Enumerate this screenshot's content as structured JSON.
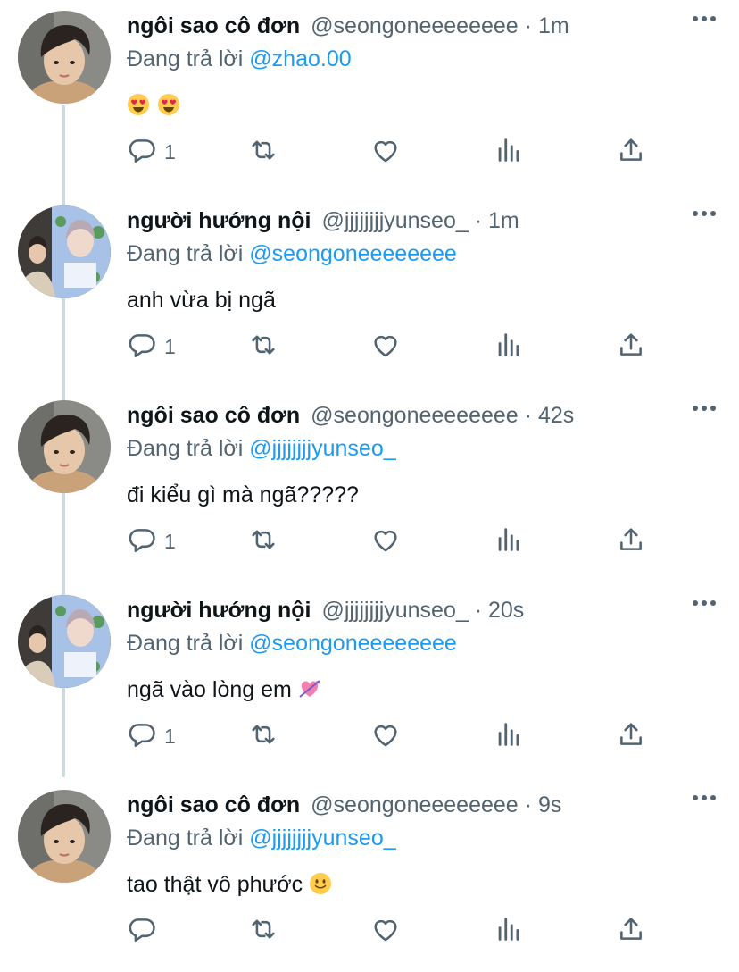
{
  "colors": {
    "link": "#1d9bf0",
    "secondary": "#536471",
    "text": "#0f1419",
    "thread_line": "#cfd9de"
  },
  "tweets": [
    {
      "name": "ngôi sao cô đơn",
      "handle": "@seongoneeeeeeee",
      "time": "1m",
      "replying_label": "Đang trả lời",
      "replying_to": "@zhao.00",
      "text": "",
      "emojis": [
        "heart-eyes-emoji",
        "heart-eyes-emoji"
      ],
      "reply_count": "1"
    },
    {
      "name": "người hướng nội",
      "handle": "@jjjjjjjjyunseo_",
      "time": "1m",
      "replying_label": "Đang trả lời",
      "replying_to": "@seongoneeeeeeee",
      "text": "anh vừa bị ngã",
      "emojis": [],
      "reply_count": "1"
    },
    {
      "name": "ngôi sao cô đơn",
      "handle": "@seongoneeeeeeee",
      "time": "42s",
      "replying_label": "Đang trả lời",
      "replying_to": "@jjjjjjjjyunseo_",
      "text": "đi kiểu gì mà ngã?????",
      "emojis": [],
      "reply_count": "1"
    },
    {
      "name": "người hướng nội",
      "handle": "@jjjjjjjjyunseo_",
      "time": "20s",
      "replying_label": "Đang trả lời",
      "replying_to": "@seongoneeeeeeee",
      "text": "ngã vào lòng em",
      "emojis": [
        "heart-with-arrow-emoji"
      ],
      "reply_count": "1"
    },
    {
      "name": "ngôi sao cô đơn",
      "handle": "@seongoneeeeeeee",
      "time": "9s",
      "replying_label": "Đang trả lời",
      "replying_to": "@jjjjjjjjyunseo_",
      "text": "tao thật vô phước",
      "emojis": [
        "slightly-smiling-emoji"
      ],
      "reply_count": ""
    }
  ]
}
